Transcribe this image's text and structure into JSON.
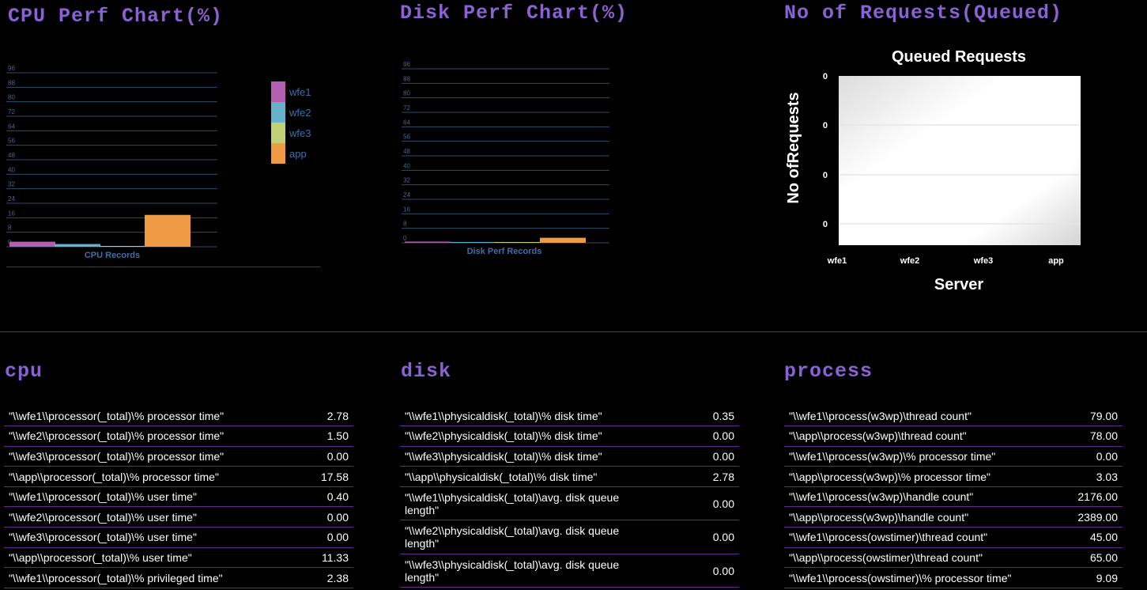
{
  "colors": {
    "heading": "#8a63d2",
    "wfe1": "#b05fb1",
    "wfe2": "#67b2ca",
    "wfe3": "#c3d076",
    "app": "#ef9b45"
  },
  "headings": {
    "cpu_chart": "CPU Perf Chart(%)",
    "disk_chart": "Disk Perf Chart(%)",
    "req_chart": "No of Requests(Queued)",
    "cpu": "cpu",
    "disk": "disk",
    "process": "process"
  },
  "chart_data": [
    {
      "type": "bar",
      "xlabel": "CPU Records",
      "categories": [
        "wfe1",
        "wfe2",
        "wfe3",
        "app"
      ],
      "values": [
        2.78,
        1.5,
        0,
        17.58
      ],
      "yticks": [
        0,
        8,
        16,
        24,
        32,
        40,
        48,
        56,
        64,
        72,
        80,
        88,
        96
      ],
      "ylim": [
        0,
        96
      ],
      "legend": [
        "wfe1",
        "wfe2",
        "wfe3",
        "app"
      ]
    },
    {
      "type": "bar",
      "xlabel": "Disk Perf Records",
      "categories": [
        "wfe1",
        "wfe2",
        "wfe3",
        "app"
      ],
      "values": [
        0.35,
        0,
        0,
        2.78
      ],
      "yticks": [
        0,
        8,
        16,
        24,
        32,
        40,
        48,
        56,
        64,
        72,
        80,
        88,
        96
      ],
      "ylim": [
        0,
        96
      ]
    },
    {
      "type": "bar",
      "title": "Queued Requests",
      "xlabel": "Server",
      "ylabel": "No ofRequests",
      "categories": [
        "wfe1",
        "wfe2",
        "wfe3",
        "app"
      ],
      "values": [
        0,
        0,
        0,
        0
      ],
      "yticks": [
        "0",
        "0",
        "0",
        "0"
      ]
    }
  ],
  "tables": {
    "cpu": [
      {
        "label": "\"\\\\wfe1\\\\processor(_total)\\% processor time\"",
        "value": "2.78"
      },
      {
        "label": "\"\\\\wfe2\\\\processor(_total)\\% processor time\"",
        "value": "1.50"
      },
      {
        "label": "\"\\\\wfe3\\\\processor(_total)\\% processor time\"",
        "value": "0.00"
      },
      {
        "label": "\"\\\\app\\\\processor(_total)\\% processor time\"",
        "value": "17.58"
      },
      {
        "label": "\"\\\\wfe1\\\\processor(_total)\\% user time\"",
        "value": "0.40"
      },
      {
        "label": "\"\\\\wfe2\\\\processor(_total)\\% user time\"",
        "value": "0.00"
      },
      {
        "label": "\"\\\\wfe3\\\\processor(_total)\\% user time\"",
        "value": "0.00"
      },
      {
        "label": "\"\\\\app\\\\processor(_total)\\% user time\"",
        "value": "11.33"
      },
      {
        "label": "\"\\\\wfe1\\\\processor(_total)\\% privileged time\"",
        "value": "2.38"
      }
    ],
    "disk": [
      {
        "label": "\"\\\\wfe1\\\\physicaldisk(_total)\\% disk time\"",
        "value": "0.35"
      },
      {
        "label": "\"\\\\wfe2\\\\physicaldisk(_total)\\% disk time\"",
        "value": "0.00"
      },
      {
        "label": "\"\\\\wfe3\\\\physicaldisk(_total)\\% disk time\"",
        "value": "0.00"
      },
      {
        "label": "\"\\\\app\\\\physicaldisk(_total)\\% disk time\"",
        "value": "2.78"
      },
      {
        "label": "\"\\\\wfe1\\\\physicaldisk(_total)\\avg. disk queue length\"",
        "value": "0.00"
      },
      {
        "label": "\"\\\\wfe2\\\\physicaldisk(_total)\\avg. disk queue length\"",
        "value": "0.00"
      },
      {
        "label": "\"\\\\wfe3\\\\physicaldisk(_total)\\avg. disk queue length\"",
        "value": "0.00"
      }
    ],
    "process": [
      {
        "label": "\"\\\\wfe1\\\\process(w3wp)\\thread count\"",
        "value": "79.00"
      },
      {
        "label": "\"\\\\app\\\\process(w3wp)\\thread count\"",
        "value": "78.00"
      },
      {
        "label": "\"\\\\wfe1\\\\process(w3wp)\\% processor time\"",
        "value": "0.00"
      },
      {
        "label": "\"\\\\app\\\\process(w3wp)\\% processor time\"",
        "value": "3.03"
      },
      {
        "label": "\"\\\\wfe1\\\\process(w3wp)\\handle count\"",
        "value": "2176.00"
      },
      {
        "label": "\"\\\\app\\\\process(w3wp)\\handle count\"",
        "value": "2389.00"
      },
      {
        "label": "\"\\\\wfe1\\\\process(owstimer)\\thread count\"",
        "value": "45.00"
      },
      {
        "label": "\"\\\\app\\\\process(owstimer)\\thread count\"",
        "value": "65.00"
      },
      {
        "label": "\"\\\\wfe1\\\\process(owstimer)\\% processor time\"",
        "value": "9.09"
      }
    ]
  }
}
